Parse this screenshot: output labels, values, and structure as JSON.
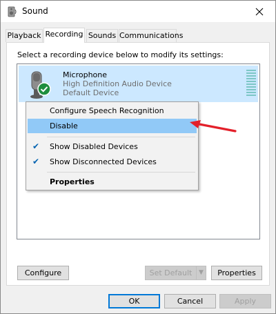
{
  "window": {
    "title": "Sound"
  },
  "tabs": [
    {
      "label": "Playback",
      "active": false
    },
    {
      "label": "Recording",
      "active": true
    },
    {
      "label": "Sounds",
      "active": false
    },
    {
      "label": "Communications",
      "active": false
    }
  ],
  "main": {
    "instructions": "Select a recording device below to modify its settings:",
    "device": {
      "name": "Microphone",
      "description": "High Definition Audio Device",
      "status": "Default Device"
    }
  },
  "context_menu": {
    "items": [
      {
        "label": "Configure Speech Recognition",
        "checked": false,
        "bold": false,
        "highlighted": false
      },
      {
        "label": "Disable",
        "checked": false,
        "bold": false,
        "highlighted": true
      },
      {
        "label": "Show Disabled Devices",
        "checked": true,
        "bold": false,
        "highlighted": false
      },
      {
        "label": "Show Disconnected Devices",
        "checked": true,
        "bold": false,
        "highlighted": false
      },
      {
        "label": "Properties",
        "checked": false,
        "bold": true,
        "highlighted": false
      }
    ]
  },
  "panel_buttons": {
    "configure": "Configure",
    "set_default": "Set Default",
    "properties": "Properties"
  },
  "dialog_buttons": {
    "ok": "OK",
    "cancel": "Cancel",
    "apply": "Apply"
  },
  "colors": {
    "selection": "#cce8ff",
    "menu_highlight": "#91c9f7",
    "check": "#0063b1",
    "arrow": "#e3202a",
    "default_badge": "#1e8e3e"
  },
  "icons": {
    "title": "speaker-icon",
    "device": "microphone-icon",
    "default_badge": "checkmark-badge-icon"
  }
}
